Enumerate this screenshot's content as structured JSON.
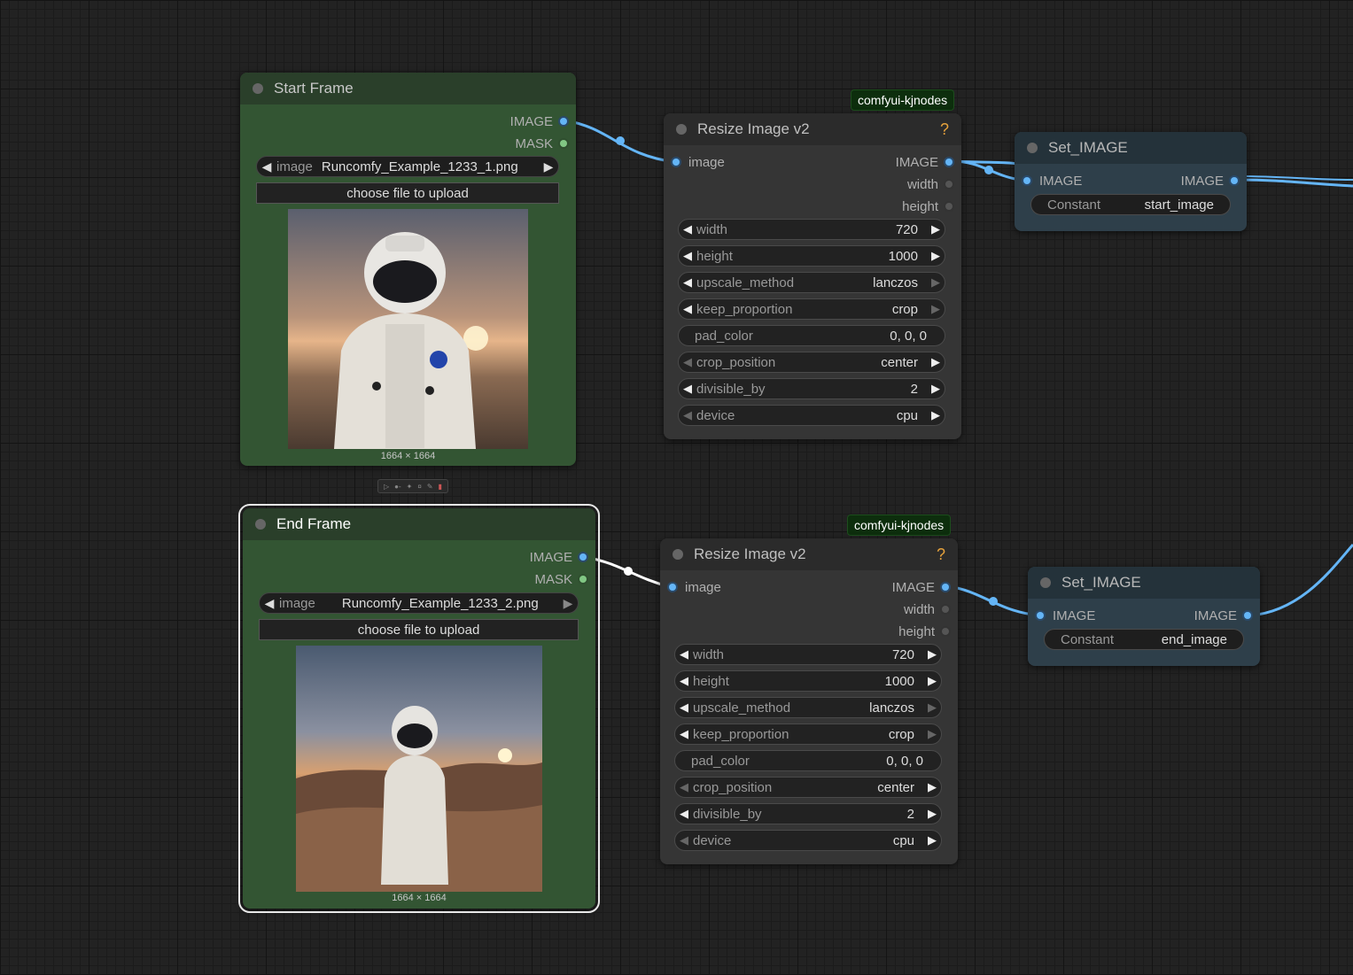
{
  "nodes": {
    "start_frame": {
      "title": "Start Frame",
      "outputs": [
        "IMAGE",
        "MASK"
      ],
      "image_label": "image",
      "image_value": "Runcomfy_Example_1233_1.png",
      "upload_label": "choose file to upload",
      "dims": "1664 × 1664"
    },
    "end_frame": {
      "title": "End Frame",
      "outputs": [
        "IMAGE",
        "MASK"
      ],
      "image_label": "image",
      "image_value": "Runcomfy_Example_1233_2.png",
      "upload_label": "choose file to upload",
      "dims": "1664 × 1664"
    },
    "resize_top": {
      "badge": "comfyui-kjnodes",
      "title": "Resize Image v2",
      "help": "?",
      "input": "image",
      "outputs": [
        "IMAGE",
        "width",
        "height"
      ],
      "widgets": [
        {
          "name": "width",
          "value": "720"
        },
        {
          "name": "height",
          "value": "1000"
        },
        {
          "name": "upscale_method",
          "value": "lanczos"
        },
        {
          "name": "keep_proportion",
          "value": "crop"
        },
        {
          "name": "pad_color",
          "value": "0, 0, 0"
        },
        {
          "name": "crop_position",
          "value": "center"
        },
        {
          "name": "divisible_by",
          "value": "2"
        },
        {
          "name": "device",
          "value": "cpu"
        }
      ]
    },
    "resize_bottom": {
      "badge": "comfyui-kjnodes",
      "title": "Resize Image v2",
      "help": "?",
      "input": "image",
      "outputs": [
        "IMAGE",
        "width",
        "height"
      ],
      "widgets": [
        {
          "name": "width",
          "value": "720"
        },
        {
          "name": "height",
          "value": "1000"
        },
        {
          "name": "upscale_method",
          "value": "lanczos"
        },
        {
          "name": "keep_proportion",
          "value": "crop"
        },
        {
          "name": "pad_color",
          "value": "0, 0, 0"
        },
        {
          "name": "crop_position",
          "value": "center"
        },
        {
          "name": "divisible_by",
          "value": "2"
        },
        {
          "name": "device",
          "value": "cpu"
        }
      ]
    },
    "set_top": {
      "title": "Set_IMAGE",
      "input": "IMAGE",
      "output": "IMAGE",
      "const_label": "Constant",
      "const_value": "start_image"
    },
    "set_bottom": {
      "title": "Set_IMAGE",
      "input": "IMAGE",
      "output": "IMAGE",
      "const_label": "Constant",
      "const_value": "end_image"
    }
  },
  "colors": {
    "image_link": "#64b5f6",
    "mask_slot": "#81c784",
    "load_node_bg": "#335533",
    "resize_node_bg": "#353535",
    "set_node_bg": "#2e3f4a",
    "badge_bg": "#0d2e0d",
    "help_icon": "#e6a23c"
  }
}
